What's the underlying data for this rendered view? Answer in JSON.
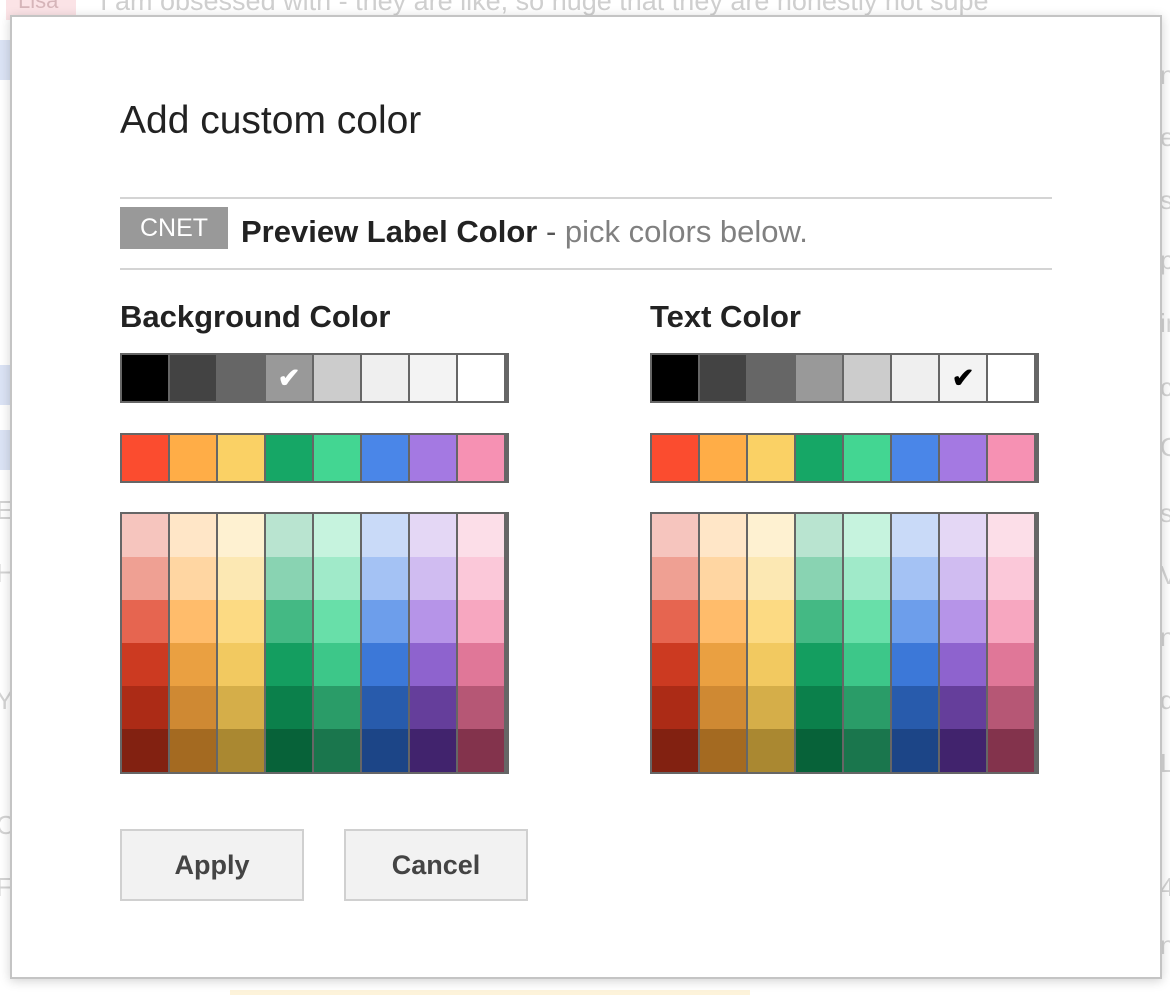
{
  "background_page": {
    "sender_chip": "Lisa",
    "snippet": "I am obsessed with - they are like, so huge that they are honestly not supe",
    "left_letters": [
      "E",
      "H",
      "Y",
      "C",
      "F"
    ],
    "right_letters": [
      "n",
      "e",
      "s",
      "p",
      "in",
      "c",
      "O",
      "s",
      "V",
      "n",
      "q",
      "L",
      "4",
      "n"
    ]
  },
  "dialog": {
    "title": "Add custom color",
    "preview": {
      "label": "CNET",
      "bold_text": "Preview Label Color",
      "dash": " - ",
      "hint": "pick colors below.",
      "background": "#999999",
      "text_color": "#ffffff"
    },
    "background_section": {
      "title": "Background Color",
      "selected_index": 3,
      "selected_row": "gray"
    },
    "text_section": {
      "title": "Text Color",
      "selected_index": 6,
      "selected_row": "gray"
    },
    "check_glyph": "✔",
    "buttons": {
      "apply": "Apply",
      "cancel": "Cancel"
    }
  },
  "palette": {
    "gray_row": [
      "#000000",
      "#434343",
      "#666666",
      "#999999",
      "#cccccc",
      "#efefef",
      "#f3f3f3",
      "#ffffff"
    ],
    "vivid_row": [
      "#fb4c2f",
      "#ffad47",
      "#fad165",
      "#16a766",
      "#43d692",
      "#4a86e8",
      "#a479e2",
      "#f691b3"
    ],
    "tint_columns": [
      [
        "#f6c5be",
        "#efa093",
        "#e66550",
        "#cc3a21",
        "#ac2b16",
        "#822111"
      ],
      [
        "#ffe6c7",
        "#ffd6a2",
        "#ffbc6b",
        "#eaa041",
        "#cf8933",
        "#a46a21"
      ],
      [
        "#fef1d1",
        "#fce8b3",
        "#fcda83",
        "#f2c960",
        "#d5ae49",
        "#aa8831"
      ],
      [
        "#b9e4d0",
        "#89d3b2",
        "#44b984",
        "#149e60",
        "#0b804b",
        "#076239"
      ],
      [
        "#c6f3de",
        "#a0eac9",
        "#68dfa9",
        "#3dc789",
        "#2a9c68",
        "#1a764d"
      ],
      [
        "#c9daf8",
        "#a4c2f4",
        "#6d9eeb",
        "#3c78d8",
        "#285bac",
        "#1c4587"
      ],
      [
        "#e4d7f5",
        "#d0bcf1",
        "#b694e8",
        "#8e63ce",
        "#653e9b",
        "#41236d"
      ],
      [
        "#fcdee8",
        "#fbc8d9",
        "#f7a7c0",
        "#e07798",
        "#b65775",
        "#83334c"
      ]
    ]
  }
}
